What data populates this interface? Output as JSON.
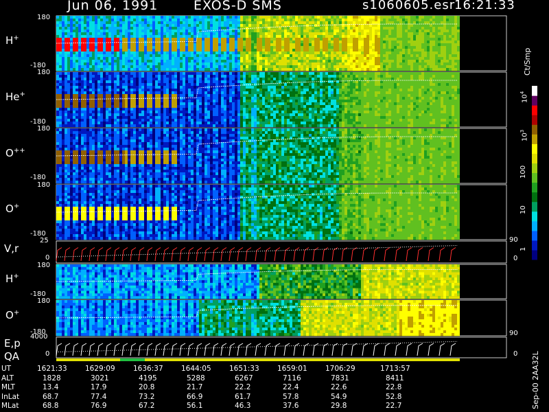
{
  "header": {
    "date": "Jun 06, 1991",
    "mission": "EXOS-D SMS",
    "file": "s1060605.esr",
    "time": "16:21:33"
  },
  "colorbar": {
    "unit": "Ct/Smp",
    "ticks": [
      {
        "label": "10",
        "sup": "4",
        "value": 10000
      },
      {
        "label": "10",
        "sup": "3",
        "value": 1000
      },
      {
        "label": "100",
        "sup": "",
        "value": 100
      },
      {
        "label": "10",
        "sup": "",
        "value": 10
      },
      {
        "label": "1",
        "sup": "",
        "value": 1
      }
    ],
    "colors": [
      "#000080",
      "#0018c0",
      "#0060ff",
      "#00b0ff",
      "#00e0e0",
      "#00a060",
      "#007010",
      "#20a020",
      "#60c020",
      "#a0d010",
      "#e0e000",
      "#ffff00",
      "#c0a000",
      "#906000",
      "#b00000",
      "#ff0000",
      "#600060",
      "#ffffff"
    ]
  },
  "chart_data": {
    "type": "heatmap",
    "title": "Jun 06, 1991   EXOS-D SMS",
    "x_axis": {
      "label": "UT",
      "range": [
        "1621:33",
        "1713:57"
      ]
    },
    "panels": [
      {
        "name": "H+",
        "label": "H",
        "sup": "+",
        "ylim": [
          -180,
          180
        ],
        "yticks": [
          "180",
          "-180"
        ]
      },
      {
        "name": "He+",
        "label": "He",
        "sup": "+",
        "ylim": [
          -180,
          180
        ],
        "yticks": [
          "180",
          "-180"
        ]
      },
      {
        "name": "O++",
        "label": "O",
        "sup": "++",
        "ylim": [
          -180,
          180
        ],
        "yticks": [
          "180",
          "-180"
        ]
      },
      {
        "name": "O+",
        "label": "O",
        "sup": "+",
        "ylim": [
          -180,
          180
        ],
        "yticks": [
          "180",
          "-180"
        ]
      },
      {
        "name": "V,r",
        "label": "V,r",
        "sup": "",
        "ylim": [
          0,
          25
        ],
        "yticks": [
          "25",
          "0"
        ],
        "right_ticks": [
          "90",
          "0"
        ]
      },
      {
        "name": "H+ (2)",
        "label": "H",
        "sup": "+",
        "ylim": [
          -180,
          180
        ],
        "yticks": [
          "180",
          "-180"
        ]
      },
      {
        "name": "O+ (2)",
        "label": "O",
        "sup": "+",
        "ylim": [
          -180,
          180
        ],
        "yticks": [
          "180",
          "-180"
        ]
      },
      {
        "name": "E,p",
        "label": "E,p",
        "sup": "",
        "ylim": [
          0,
          4000
        ],
        "yticks": [
          "4000",
          "0"
        ],
        "right_ticks": [
          "90",
          "0"
        ]
      }
    ],
    "qa_label": "QA",
    "table": {
      "rows": [
        {
          "label": "UT",
          "values": [
            "1621:33",
            "1629:09",
            "1636:37",
            "1644:05",
            "1651:33",
            "1659:01",
            "1706:29",
            "1713:57"
          ]
        },
        {
          "label": "ALT",
          "values": [
            "1828",
            "3021",
            "4195",
            "5288",
            "6267",
            "7116",
            "7831",
            "8411"
          ]
        },
        {
          "label": "MLT",
          "values": [
            "13.4",
            "17.9",
            "20.8",
            "21.7",
            "22.2",
            "22.4",
            "22.6",
            "22.8"
          ]
        },
        {
          "label": "InLat",
          "values": [
            "68.7",
            "77.4",
            "73.2",
            "66.9",
            "61.7",
            "57.8",
            "54.9",
            "52.8"
          ]
        },
        {
          "label": "MLat",
          "values": [
            "68.8",
            "76.9",
            "67.2",
            "56.1",
            "46.3",
            "37.6",
            "29.8",
            "22.7"
          ]
        }
      ]
    }
  },
  "footer": {
    "stamp": "Sep-00 2AA32L"
  }
}
